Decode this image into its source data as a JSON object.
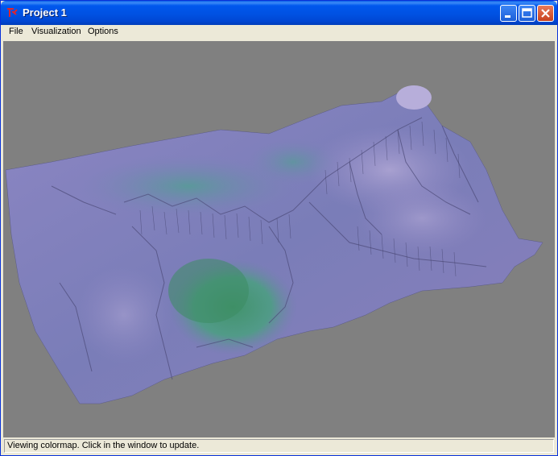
{
  "window": {
    "title": "Project 1",
    "icon": "tk-feather-icon"
  },
  "titlebar_buttons": {
    "minimize": "minimize-icon",
    "maximize": "maximize-icon",
    "close": "close-icon"
  },
  "menu": {
    "file": "File",
    "visualization": "Visualization",
    "options": "Options"
  },
  "viewport": {
    "background": "#808080",
    "content": "3d-terrain-surface",
    "colors": {
      "purple": "#8A7FC0",
      "lavender": "#A39AC9",
      "slate": "#6F73A8",
      "teal": "#4E9C8E",
      "green": "#3E8E6A"
    }
  },
  "status": {
    "text": "Viewing colormap.  Click in the window to update."
  }
}
